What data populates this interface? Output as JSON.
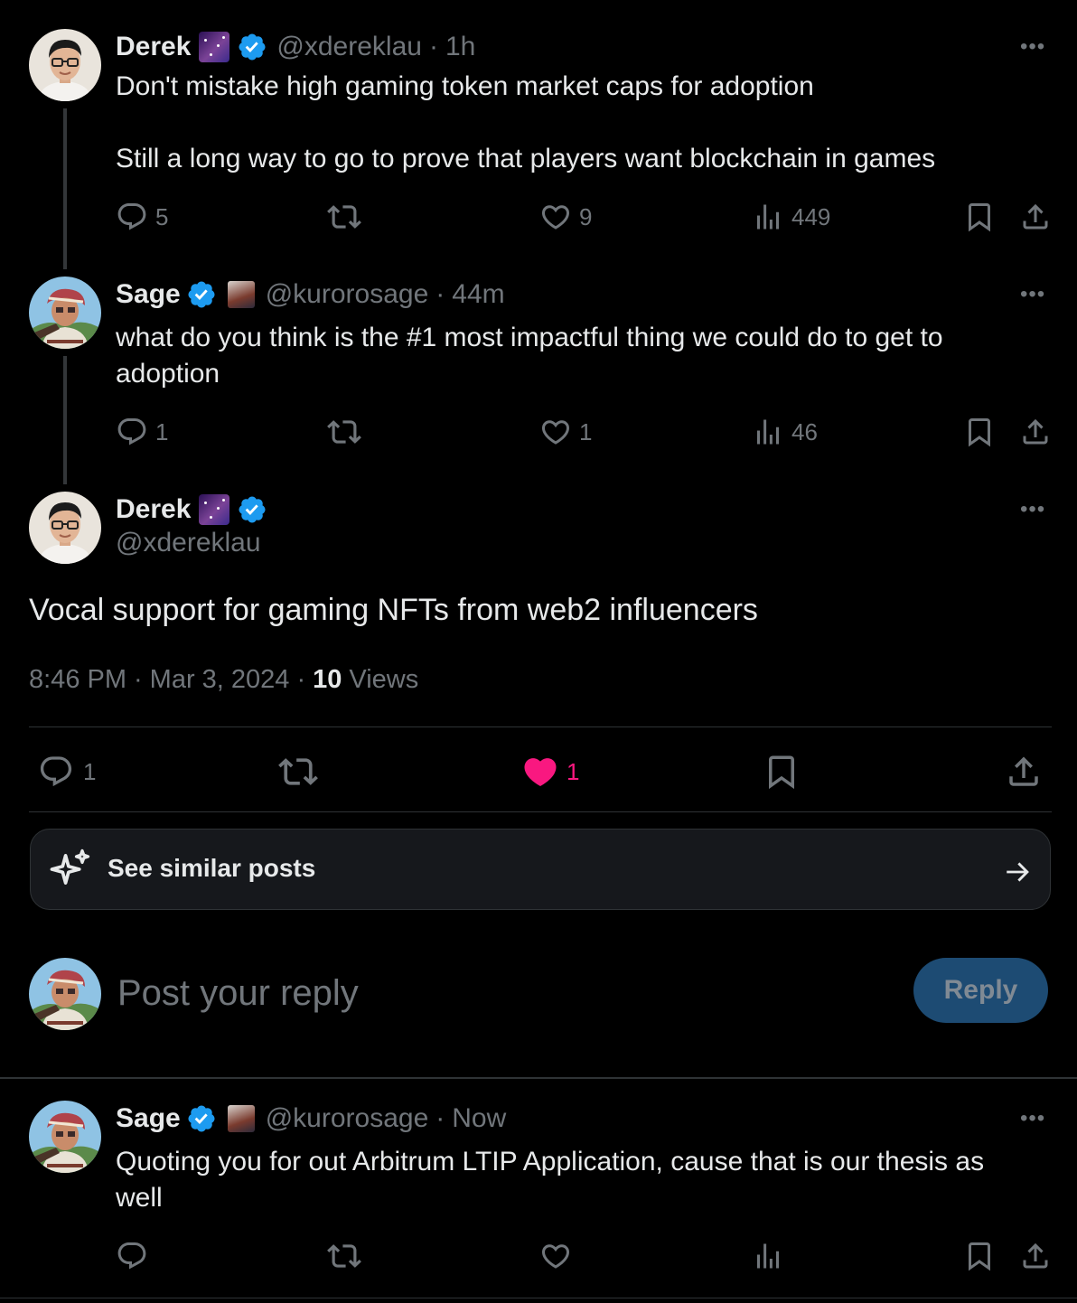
{
  "thread": [
    {
      "name": "Derek",
      "handle": "@xdereklau",
      "time": "1h",
      "text": "Don't mistake high gaming token market caps for adoption\n\nStill a long way to go to prove that players want blockchain in games",
      "replies": "5",
      "likes": "9",
      "views": "449"
    },
    {
      "name": "Sage",
      "handle": "@kurorosage",
      "time": "44m",
      "text": "what do you think is the #1 most impactful thing we could do to get to adoption",
      "replies": "1",
      "likes": "1",
      "views": "46"
    }
  ],
  "main_post": {
    "name": "Derek",
    "handle": "@xdereklau",
    "text": "Vocal support for gaming NFTs from web2 influencers",
    "time": "8:46 PM",
    "date": "Mar 3, 2024",
    "views_count": "10",
    "views_label": "Views",
    "replies": "1",
    "likes": "1"
  },
  "similar": {
    "label": "See similar posts"
  },
  "composer": {
    "placeholder": "Post your reply",
    "button": "Reply"
  },
  "reply": {
    "name": "Sage",
    "handle": "@kurorosage",
    "time": "Now",
    "text": "Quoting you for out Arbitrum LTIP Application, cause that is our thesis as well"
  },
  "separator": "·",
  "more": "•••",
  "colors": {
    "like_active": "#f91880",
    "verified": "#1d9bf0",
    "reply_button": "#1d4b73"
  }
}
